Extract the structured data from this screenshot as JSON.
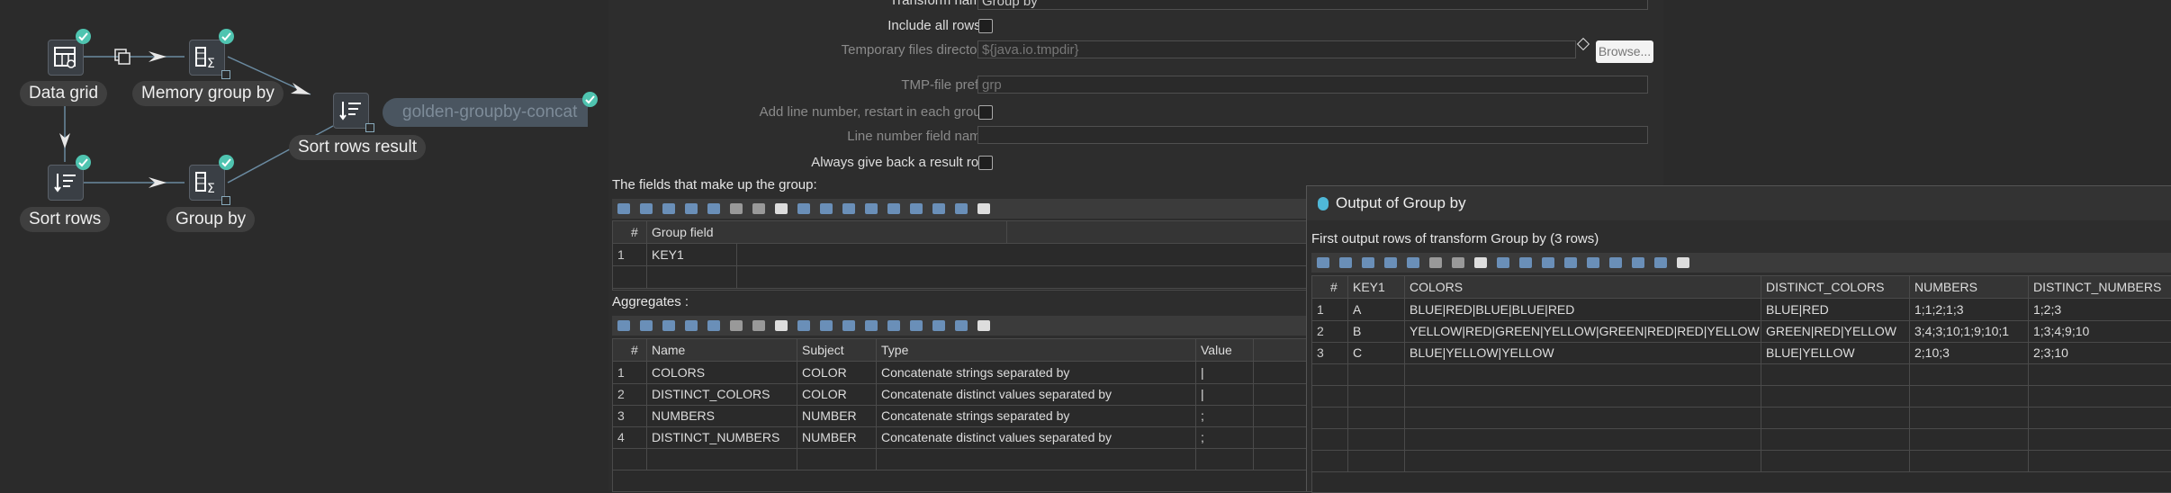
{
  "pipeline": {
    "nodes": {
      "data_grid": "Data grid",
      "memory_group_by": "Memory group by",
      "sort_rows_result": "Sort rows result",
      "sort_rows": "Sort rows",
      "group_by": "Group by"
    },
    "ghost_label": "golden-groupby-concat"
  },
  "dialog": {
    "transform_name_label": "Transform name",
    "transform_name_value": "Group by",
    "include_all_rows_label": "Include all rows?",
    "temp_dir_label": "Temporary files directory",
    "temp_dir_value": "${java.io.tmpdir}",
    "browse_label": "Browse...",
    "tmp_prefix_label": "TMP-file prefix",
    "tmp_prefix_value": "grp",
    "add_line_label": "Add line number, restart in each group",
    "line_field_label": "Line number field name",
    "always_result_label": "Always give back a result row",
    "group_section_label": "The fields that make up the group:",
    "group_table": {
      "headers": [
        "#",
        "Group field"
      ],
      "rows": [
        [
          "1",
          "KEY1"
        ]
      ]
    },
    "aggregates_label": "Aggregates :",
    "agg_table": {
      "headers": [
        "#",
        "Name",
        "Subject",
        "Type",
        "Value"
      ],
      "rows": [
        [
          "1",
          "COLORS",
          "COLOR",
          "Concatenate strings separated by",
          "|"
        ],
        [
          "2",
          "DISTINCT_COLORS",
          "COLOR",
          "Concatenate distinct values separated by",
          "|"
        ],
        [
          "3",
          "NUMBERS",
          "NUMBER",
          "Concatenate strings separated by",
          ";"
        ],
        [
          "4",
          "DISTINCT_NUMBERS",
          "NUMBER",
          "Concatenate distinct values separated by",
          ";"
        ]
      ]
    }
  },
  "output": {
    "title": "Output of Group by",
    "subtitle": "First output rows of transform Group by (3 rows)",
    "headers": [
      "#",
      "KEY1",
      "COLORS",
      "DISTINCT_COLORS",
      "NUMBERS",
      "DISTINCT_NUMBERS"
    ],
    "rows": [
      [
        "1",
        "A",
        "BLUE|RED|BLUE|BLUE|RED",
        "BLUE|RED",
        "1;1;2;1;3",
        "1;2;3"
      ],
      [
        "2",
        "B",
        "YELLOW|RED|GREEN|YELLOW|GREEN|RED|RED|YELLOW",
        "GREEN|RED|YELLOW",
        "3;4;3;10;1;9;10;1",
        "1;3;4;9;10"
      ],
      [
        "3",
        "C",
        "BLUE|YELLOW|YELLOW",
        "BLUE|YELLOW",
        "2;10;3",
        "2;3;10"
      ]
    ]
  },
  "colors": {
    "accent_check": "#4fc4b0",
    "background": "#2b2b2b"
  }
}
